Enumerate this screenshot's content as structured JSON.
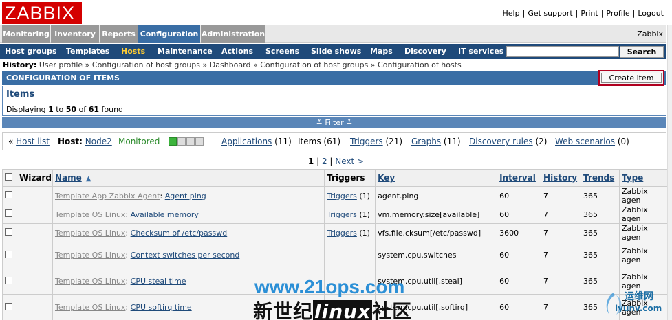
{
  "logo": "ZABBIX",
  "top_links": [
    "Help",
    "Get support",
    "Print",
    "Profile",
    "Logout"
  ],
  "main_menu": {
    "tabs": [
      "Monitoring",
      "Inventory",
      "Reports",
      "Configuration",
      "Administration"
    ],
    "active": "Configuration",
    "user": "Zabbix"
  },
  "sub_menu": {
    "items": [
      "Host groups",
      "Templates",
      "Hosts",
      "Maintenance",
      "Actions",
      "Screens",
      "Slide shows",
      "Maps",
      "Discovery",
      "IT services"
    ],
    "active": "Hosts",
    "search_button": "Search",
    "search_value": ""
  },
  "history": {
    "label": "History:",
    "crumbs": [
      "User profile",
      "Configuration of host groups",
      "Dashboard",
      "Configuration of host groups",
      "Configuration of hosts"
    ]
  },
  "section": {
    "title": "CONFIGURATION OF ITEMS",
    "create_button": "Create item"
  },
  "items_box": {
    "title": "Items",
    "displaying_prefix": "Displaying",
    "from": "1",
    "to_word": "to",
    "to": "50",
    "of_word": "of",
    "total": "61",
    "found": "found"
  },
  "filter_label": "≚ Filter ≚",
  "host_bar": {
    "host_list": "Host list",
    "host_label": "Host:",
    "host_name": "Node2",
    "status": "Monitored",
    "applications": "Applications",
    "applications_count": "(11)",
    "items": "Items (61)",
    "triggers": "Triggers",
    "triggers_count": "(21)",
    "graphs": "Graphs",
    "graphs_count": "(11)",
    "discovery": "Discovery rules",
    "discovery_count": "(2)",
    "web": "Web scenarios",
    "web_count": "(0)"
  },
  "pager": {
    "current": "1",
    "page2": "2",
    "next": "Next >"
  },
  "table": {
    "headers": [
      "Wizard",
      "Name",
      "Triggers",
      "Key",
      "Interval",
      "History",
      "Trends",
      "Type"
    ],
    "rows": [
      {
        "template": "Template App Zabbix Agent",
        "name": "Agent ping",
        "triggers": "Triggers",
        "triggers_count": "(1)",
        "key": "agent.ping",
        "interval": "60",
        "history": "7",
        "trends": "365",
        "type": "Zabbix agen"
      },
      {
        "template": "Template OS Linux",
        "name": "Available memory",
        "triggers": "Triggers",
        "triggers_count": "(1)",
        "key": "vm.memory.size[available]",
        "interval": "60",
        "history": "7",
        "trends": "365",
        "type": "Zabbix agen"
      },
      {
        "template": "Template OS Linux",
        "name": "Checksum of /etc/passwd",
        "triggers": "Triggers",
        "triggers_count": "(1)",
        "key": "vfs.file.cksum[/etc/passwd]",
        "interval": "3600",
        "history": "7",
        "trends": "365",
        "type": "Zabbix agen"
      },
      {
        "template": "Template OS Linux",
        "name": "Context switches per second",
        "triggers": "",
        "triggers_count": "",
        "key": "system.cpu.switches",
        "interval": "60",
        "history": "7",
        "trends": "365",
        "type": "Zabbix agen"
      },
      {
        "template": "Template OS Linux",
        "name": "CPU steal time",
        "triggers": "",
        "triggers_count": "",
        "key": "system.cpu.util[,steal]",
        "interval": "60",
        "history": "7",
        "trends": "365",
        "type": "Zabbix agen"
      },
      {
        "template": "Template OS Linux",
        "name": "CPU softirq time",
        "triggers": "",
        "triggers_count": "",
        "key": "system.cpu.util[,softirq]",
        "interval": "60",
        "history": "7",
        "trends": "365",
        "type": "Zabbix agen"
      }
    ]
  },
  "watermark": {
    "url": "www.21ops.com",
    "cn_prefix": "新世纪",
    "cn_linux": "linux",
    "cn_suffix": "社区",
    "site_cn": "运维网",
    "site_en": "iyunv.com"
  },
  "colors": {
    "logo_red": "#d40000",
    "menu_blue": "#1f4a7a",
    "active_tab": "#3a6ea5",
    "active_submenu": "#ffcc33",
    "monitored": "#2a8a2a"
  }
}
